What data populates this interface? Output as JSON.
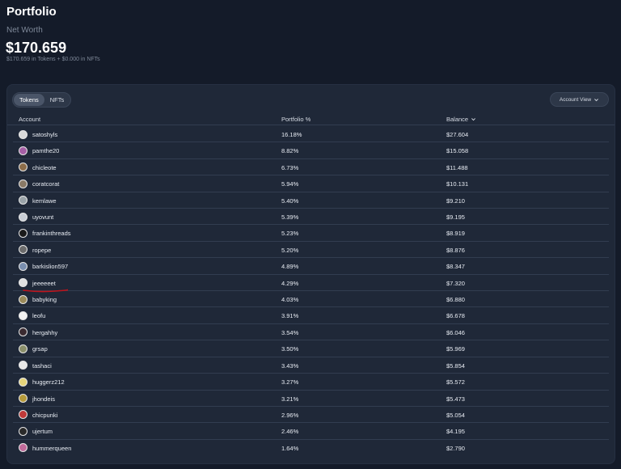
{
  "header": {
    "title": "Portfolio",
    "net_worth_label": "Net Worth",
    "net_worth_value": "$170.659",
    "net_worth_sub": "$170.659 in Tokens + $0.000 in NFTs"
  },
  "toolbar": {
    "tabs": [
      {
        "label": "Tokens",
        "active": true
      },
      {
        "label": "NFTs",
        "active": false
      }
    ],
    "view_label": "Account View"
  },
  "table": {
    "columns": [
      "Account",
      "Portfolio %",
      "Balance"
    ],
    "rows": [
      {
        "name": "satoshyls",
        "pct": "16.18%",
        "balance": "$27.604",
        "color": "#d9d9d9"
      },
      {
        "name": "pamthe20",
        "pct": "8.82%",
        "balance": "$15.058",
        "color": "#a55fa5"
      },
      {
        "name": "chicleote",
        "pct": "6.73%",
        "balance": "$11.488",
        "color": "#8c6d4a"
      },
      {
        "name": "coratcorat",
        "pct": "5.94%",
        "balance": "$10.131",
        "color": "#8a7a66"
      },
      {
        "name": "kemlawe",
        "pct": "5.40%",
        "balance": "$9.210",
        "color": "#9aa3a8"
      },
      {
        "name": "uyovunt",
        "pct": "5.39%",
        "balance": "$9.195",
        "color": "#c9ced6"
      },
      {
        "name": "frankinthreads",
        "pct": "5.23%",
        "balance": "$8.919",
        "color": "#1a1a1a"
      },
      {
        "name": "ropepe",
        "pct": "5.20%",
        "balance": "$8.876",
        "color": "#6c6c6c"
      },
      {
        "name": "barkislion597",
        "pct": "4.89%",
        "balance": "$8.347",
        "color": "#7a8fb0"
      },
      {
        "name": "jeeeeeet",
        "pct": "4.29%",
        "balance": "$7.320",
        "color": "#e0e0e0"
      },
      {
        "name": "babyking",
        "pct": "4.03%",
        "balance": "$6.880",
        "color": "#9a8a5a"
      },
      {
        "name": "leofu",
        "pct": "3.91%",
        "balance": "$6.678",
        "color": "#f2f2f2"
      },
      {
        "name": "hergahhy",
        "pct": "3.54%",
        "balance": "$6.046",
        "color": "#3a2a30"
      },
      {
        "name": "grsap",
        "pct": "3.50%",
        "balance": "$5.969",
        "color": "#8a8f6a"
      },
      {
        "name": "tashaci",
        "pct": "3.43%",
        "balance": "$5.854",
        "color": "#e8e8e8"
      },
      {
        "name": "huggerz212",
        "pct": "3.27%",
        "balance": "$5.572",
        "color": "#e5d47a"
      },
      {
        "name": "jhondeis",
        "pct": "3.21%",
        "balance": "$5.473",
        "color": "#b59a3a"
      },
      {
        "name": "chicpunki",
        "pct": "2.96%",
        "balance": "$5.054",
        "color": "#c03a3a"
      },
      {
        "name": "ujertum",
        "pct": "2.46%",
        "balance": "$4.195",
        "color": "#2a2a2a"
      },
      {
        "name": "hummerqueen",
        "pct": "1.64%",
        "balance": "$2.790",
        "color": "#c06a9a"
      }
    ]
  },
  "annotation": {
    "marked_row": "jeeeeeet",
    "color": "#c0141c"
  }
}
